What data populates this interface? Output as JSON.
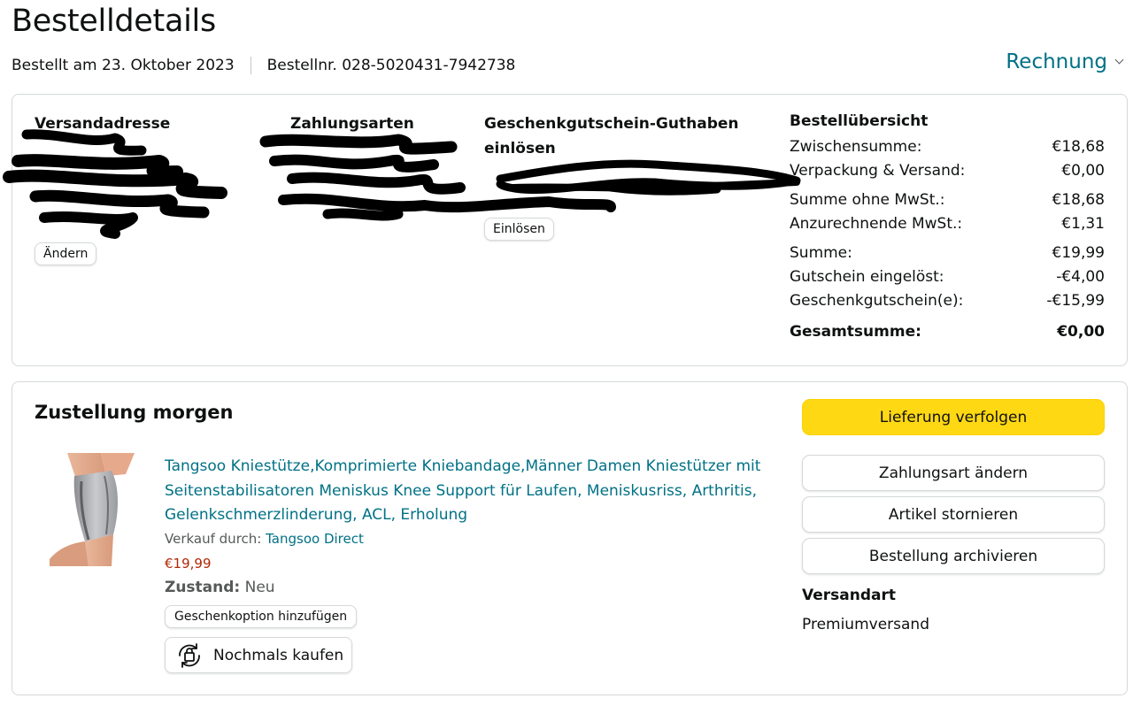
{
  "page": {
    "title": "Bestelldetails",
    "ordered_on": "Bestellt am 23. Oktober 2023",
    "order_number": "Bestellnr. 028-5020431-7942738",
    "invoice_label": "Rechnung"
  },
  "addresses": {
    "shipping_title": "Versandadresse",
    "change_button": "Ändern",
    "payment_title": "Zahlungsarten",
    "giftcard_title_line1": "Geschenkgutschein-Guthaben",
    "giftcard_title_line2": "einlösen",
    "redeem_button": "Einlösen"
  },
  "summary": {
    "title": "Bestellübersicht",
    "rows": [
      {
        "label": "Zwischensumme:",
        "value": "€18,68"
      },
      {
        "label": "Verpackung & Versand:",
        "value": "€0,00"
      },
      {
        "label": "Summe ohne MwSt.:",
        "value": "€18,68"
      },
      {
        "label": "Anzurechnende MwSt.:",
        "value": "€1,31"
      },
      {
        "label": "Summe:",
        "value": "€19,99"
      },
      {
        "label": "Gutschein eingelöst:",
        "value": "-€4,00"
      },
      {
        "label": "Geschenkgutschein(e):",
        "value": "-€15,99"
      }
    ],
    "total_label": "Gesamtsumme:",
    "total_value": "€0,00"
  },
  "delivery": {
    "title": "Zustellung morgen",
    "product": {
      "title": "Tangsoo Kniestütze,Komprimierte Kniebandage,Männer Damen Kniestützer mit Seitenstabilisatoren Meniskus Knee Support für Laufen, Meniskusriss, Arthritis, Gelenkschmerzlinderung, ACL, Erholung",
      "sold_by_label": "Verkauf durch:",
      "seller": "Tangsoo Direct",
      "price": "€19,99",
      "condition_label": "Zustand:",
      "condition_value": "Neu",
      "gift_button": "Geschenkoption hinzufügen",
      "buy_again_button": "Nochmals kaufen"
    },
    "actions": {
      "track": "Lieferung verfolgen",
      "change_payment": "Zahlungsart ändern",
      "cancel": "Artikel stornieren",
      "archive": "Bestellung archivieren"
    },
    "shipping_type_label": "Versandart",
    "shipping_type_value": "Premiumversand"
  },
  "colors": {
    "link": "#007185",
    "price": "#b12704",
    "primary_button": "#ffd814",
    "border": "#d5d9d9"
  }
}
